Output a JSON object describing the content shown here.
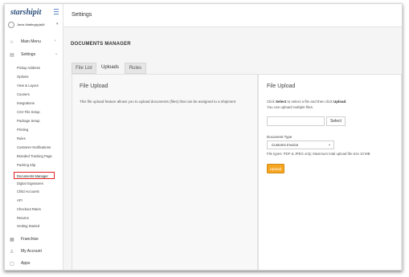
{
  "app": {
    "logo": "starshipit"
  },
  "user": {
    "name": "Janis Mattingly(at)if"
  },
  "sidebar": {
    "main_menu": "Main Menu",
    "settings": "Settings",
    "settings_items": [
      "Pickup Address",
      "Options",
      "View & Layout",
      "Couriers",
      "Integrations",
      "CSV File Setup",
      "Package Setup",
      "Printing",
      "Rules",
      "Customer Notifications",
      "Branded Tracking Page",
      "Packing Slip",
      "Documents Manager",
      "Digital Signatures",
      "Child Accounts",
      "API",
      "Checkout Rates",
      "Returns",
      "Getting Started"
    ],
    "franchise": "Franchise",
    "my_account": "My Account",
    "apps": "Apps"
  },
  "header": {
    "title": "Settings"
  },
  "page": {
    "section_title": "DOCUMENTS MANAGER",
    "tabs": [
      "File List",
      "Uploads",
      "Rules"
    ],
    "left_panel": {
      "heading": "File Upload",
      "description": "This file upload feature allows you to upload documents (files) that can be assigned to a shipment"
    },
    "right_panel": {
      "heading": "File Upload",
      "instruction_prefix": "Click ",
      "instruction_select": "Select",
      "instruction_mid": " to select a file and then click ",
      "instruction_upload": "Upload",
      "instruction_end": ".",
      "instruction_line2": "You can upload multiple files.",
      "select_button": "Select",
      "doc_type_label": "Document Type",
      "doc_type_value": "Customs Invoice",
      "file_types": "File types: PDF & JPEG only; Maximum total upload file size 10 MB",
      "upload_button": "Upload"
    }
  }
}
